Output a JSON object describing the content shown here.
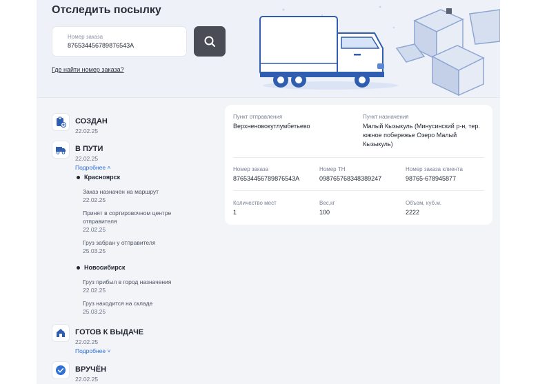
{
  "header": {
    "title": "Отследить посылку",
    "order_label": "Номер заказа",
    "order_value": "876534456789876543А",
    "help_link": "Где найти номер заказа?",
    "search_icon": "search-icon"
  },
  "timeline": {
    "stages": [
      {
        "title": "СОЗДАН",
        "date": "22.02.25",
        "icon": "clipboard-add-icon"
      },
      {
        "title": "В ПУТИ",
        "date": "22.02.25",
        "more": "Подробнее ˄",
        "icon": "truck-icon"
      },
      {
        "title": "ГОТОВ К ВЫДАЧЕ",
        "date": "22.02.25",
        "more": "Подробнее ˅",
        "icon": "pickup-point-icon"
      },
      {
        "title": "ВРУЧЁН",
        "date": "22.02.25",
        "icon": "check-circle-icon"
      }
    ],
    "cities": [
      {
        "name": "Красноярск",
        "events": [
          {
            "text": "Заказ назначен на маршрут",
            "date": "22.02.25"
          },
          {
            "text": "Принят в сортировочном центре отправителя",
            "date": "22.02.25"
          },
          {
            "text": "Груз забран у отправителя",
            "date": "25.03.25"
          }
        ]
      },
      {
        "name": "Новосибирск",
        "events": [
          {
            "text": "Груз прибыл в город назначения",
            "date": "22.02.25"
          },
          {
            "text": "Груз находится на складе",
            "date": "25.03.25"
          }
        ]
      }
    ]
  },
  "details": {
    "origin_label": "Пункт отправления",
    "origin_value": "Верхненовокутлумбетьево",
    "dest_label": "Пункт назначения",
    "dest_value": "Малый Кызыкуль (Минусинский р-н, тер. южное побережье Озеро Малый Кызыкуль)",
    "order_label": "Номер заказа",
    "order_value": "876534456789876543А",
    "tn_label": "Номер ТН",
    "tn_value": "098765768348389247",
    "client_label": "Номер заказа клиента",
    "client_value": "98765-678945877",
    "places_label": "Количество мест",
    "places_value": "1",
    "weight_label": "Вес,кг",
    "weight_value": "100",
    "volume_label": "Объем, куб.м.",
    "volume_value": "2222"
  },
  "colors": {
    "accent": "#2f6fd6",
    "search_button": "#4a4d55",
    "panel": "#f2f4f8"
  }
}
